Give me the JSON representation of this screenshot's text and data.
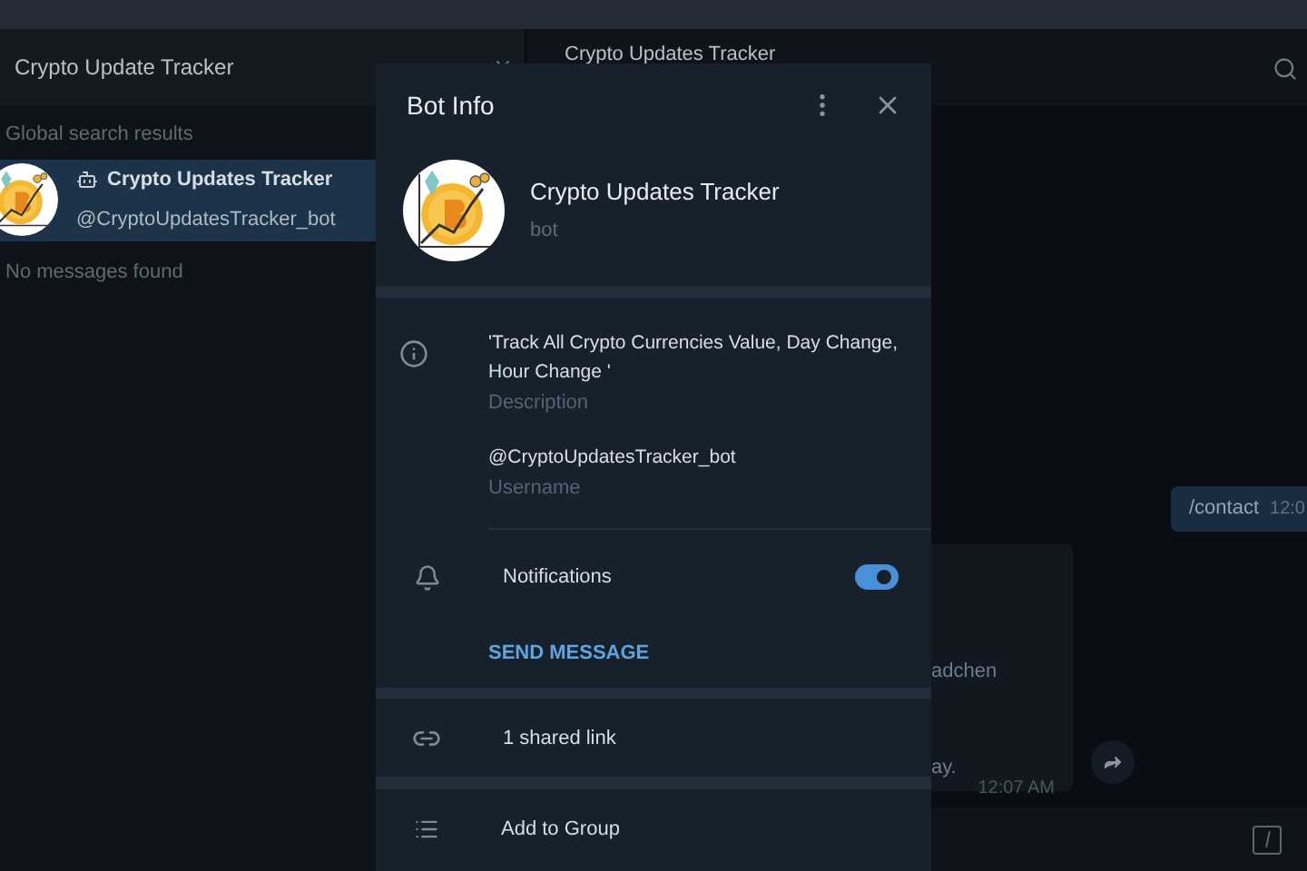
{
  "sidebar": {
    "search": {
      "value": "Crypto Update Tracker"
    },
    "section_title": "Global search results",
    "results": [
      {
        "title": "Crypto Updates Tracker",
        "subtitle": "@CryptoUpdatesTracker_bot",
        "selected": true
      }
    ],
    "empty_text": "No messages found"
  },
  "chat": {
    "title": "Crypto Updates Tracker",
    "messages": [
      {
        "kind": "outgoing",
        "text": "/contact",
        "time": "12:0"
      },
      {
        "kind": "incoming",
        "lines": [
          "adchen",
          "ay."
        ],
        "time": "12:07 AM"
      }
    ]
  },
  "modal": {
    "title": "Bot Info",
    "name": "Crypto Updates Tracker",
    "status": "bot",
    "info": [
      {
        "value": "'Track All Crypto Currencies Value, Day Change, Hour Change '",
        "label": "Description"
      },
      {
        "value": "@CryptoUpdatesTracker_bot",
        "label": "Username"
      }
    ],
    "notifications": {
      "label": "Notifications",
      "on": true
    },
    "send_message": "SEND MESSAGE",
    "shared_links": "1 shared link",
    "add_to_group": "Add to Group"
  }
}
